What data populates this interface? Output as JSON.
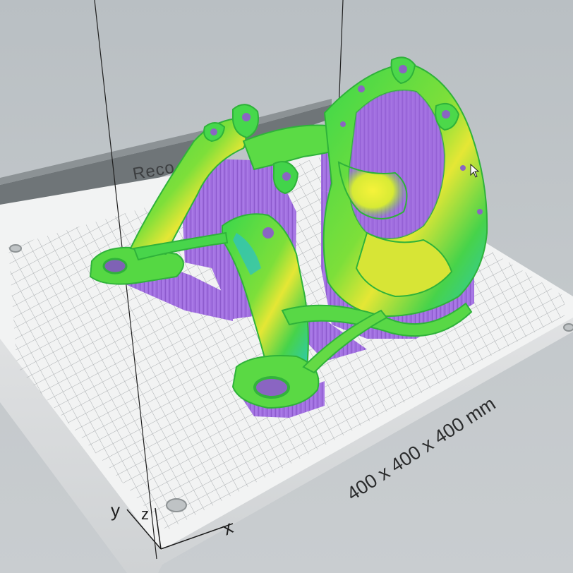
{
  "viewport": {
    "bed": {
      "front_label": "Reco",
      "dimensions_label": "400 x 400 x 400 mm"
    },
    "axes": {
      "x_label": "x",
      "y_label": "y",
      "z_label": "z"
    }
  },
  "colors": {
    "background": "#c3c8cb",
    "bed_surface": "#f1f2f2",
    "bed_grid": "#a9adb0",
    "bed_edge": "#dfe1e2",
    "back_wall": "#6f7578",
    "support_material": "#9b63d8",
    "model_green": "#3fd84a",
    "model_yellow": "#e8e632",
    "model_cyan": "#33c8c0"
  },
  "icons": [
    "mouse-cursor-icon",
    "axis-gizmo-icon"
  ]
}
